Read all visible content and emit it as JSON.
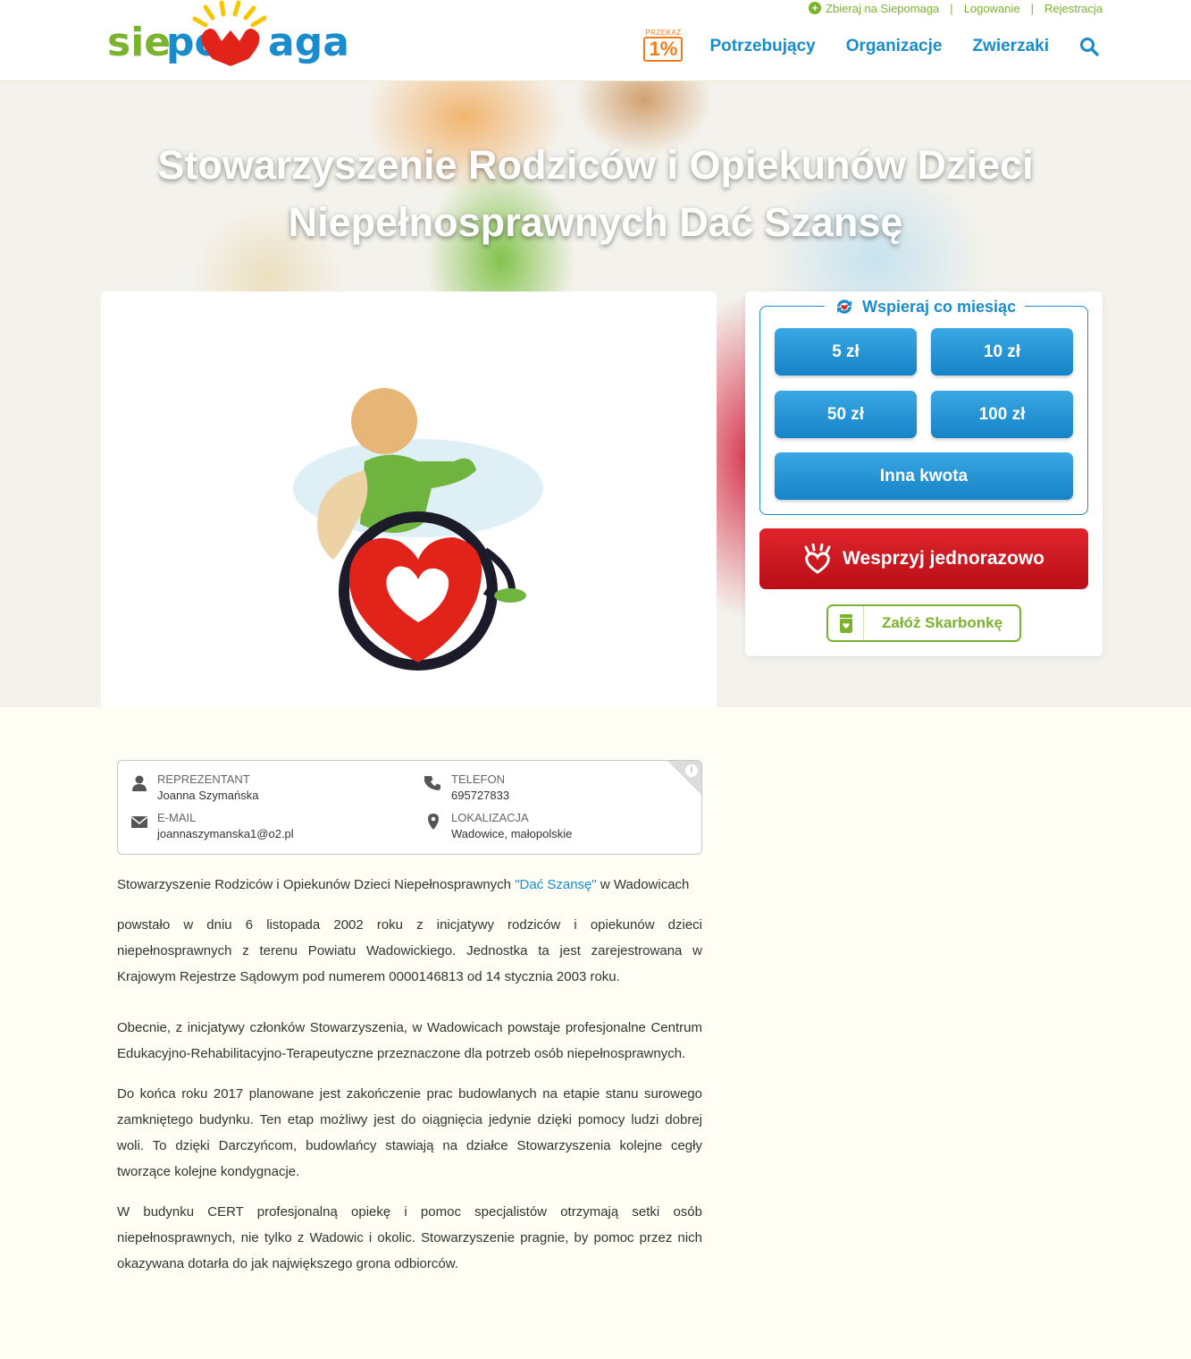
{
  "header": {
    "logo_text": "siepomaga",
    "top_links": {
      "collect": "Zbieraj na Siepomaga",
      "login": "Logowanie",
      "register": "Rejestracja"
    },
    "one_percent": {
      "label": "PRZEKAŻ",
      "value": "1%"
    },
    "nav": [
      "Potrzebujący",
      "Organizacje",
      "Zwierzaki"
    ]
  },
  "hero": {
    "title_line1": "Stowarzyszenie Rodziców i Opiekunów Dzieci",
    "title_line2": "Niepełnosprawnych Dać Szansę"
  },
  "donate": {
    "monthly_title": "Wspieraj co miesiąc",
    "amounts": [
      "5 zł",
      "10 zł",
      "50 zł",
      "100 zł"
    ],
    "other_amount": "Inna kwota",
    "once": "Wesprzyj jednorazowo",
    "piggy": "Załóż Skarbonkę"
  },
  "info": {
    "representative_label": "REPREZENTANT",
    "representative": "Joanna Szymańska",
    "phone_label": "TELEFON",
    "phone": "695727833",
    "email_label": "E-MAIL",
    "email": "joannaszymanska1@o2.pl",
    "location_label": "LOKALIZACJA",
    "location": "Wadowice, małopolskie"
  },
  "description": {
    "p1_before": "Stowarzyszenie Rodziców i Opiekunów Dzieci Niepełnosprawnych ",
    "p1_link": "\"Dać Szansę\"",
    "p1_after": " w Wadowicach",
    "p2": "powstało w dniu 6 listopada 2002 roku z inicjatywy rodziców i opiekunów dzieci niepełnosprawnych z terenu Powiatu Wadowickiego. Jednostka ta jest zarejestrowana w Krajowym Rejestrze Sądowym pod numerem 0000146813 od 14 stycznia 2003 roku.",
    "p3": "Obecnie, z inicjatywy członków Stowarzyszenia, w Wadowicach powstaje profesjonalne Centrum Edukacyjno-Rehabilitacyjno-Terapeutyczne przeznaczone dla potrzeb osób niepełnosprawnych.",
    "p4": "Do końca roku 2017 planowane jest zakończenie prac budowlanych na etapie stanu surowego zamkniętego budynku. Ten etap możliwy jest do oiągnięcia jedynie dzięki pomocy ludzi dobrej woli. To dzięki Darczyńcom, budowlańcy stawiają na działce Stowarzyszenia kolejne cegły tworzące kolejne kondygnacje.",
    "p5": "W budynku CERT profesjonalną opiekę i pomoc specjalistów otrzymają setki osób niepełnosprawnych, nie tylko z Wadowic i okolic. Stowarzyszenie pragnie, by pomoc przez nich okazywana dotarła do jak największego grona odbiorców."
  },
  "colors": {
    "brand_blue": "#1a8ccb",
    "brand_green": "#7bb32e",
    "donate_red": "#d01a22",
    "orange": "#f07a1c"
  }
}
